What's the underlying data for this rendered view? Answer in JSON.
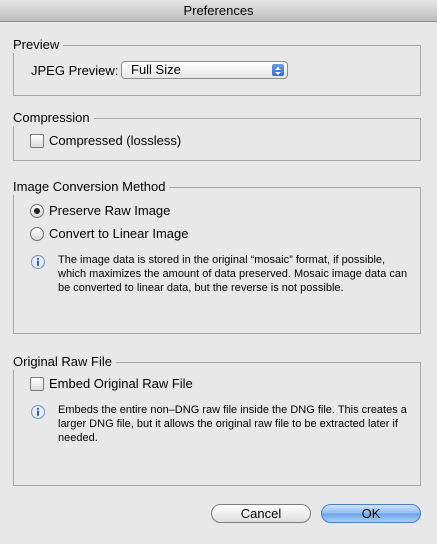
{
  "window": {
    "title": "Preferences"
  },
  "preview": {
    "legend": "Preview",
    "jpeg_label": "JPEG Preview:",
    "jpeg_value": "Full Size"
  },
  "compression": {
    "legend": "Compression",
    "compressed_label": "Compressed (lossless)",
    "compressed_checked": false
  },
  "conversion": {
    "legend": "Image Conversion Method",
    "options": [
      {
        "label": "Preserve Raw Image",
        "selected": true
      },
      {
        "label": "Convert to Linear Image",
        "selected": false
      }
    ],
    "info": "The image data is stored in the original “mosaic” format, if possible, which maximizes the amount of data preserved. Mosaic image data can be converted to linear data, but the reverse is not possible."
  },
  "raw": {
    "legend": "Original Raw File",
    "embed_label": "Embed Original Raw File",
    "embed_checked": false,
    "info": "Embeds the entire non–DNG raw file inside the DNG file.  This creates a larger DNG file, but it allows the original raw file to be extracted later if needed."
  },
  "buttons": {
    "cancel": "Cancel",
    "ok": "OK"
  },
  "colors": {
    "accent": "#3a78d8",
    "info_icon": "#4a7fc1"
  }
}
